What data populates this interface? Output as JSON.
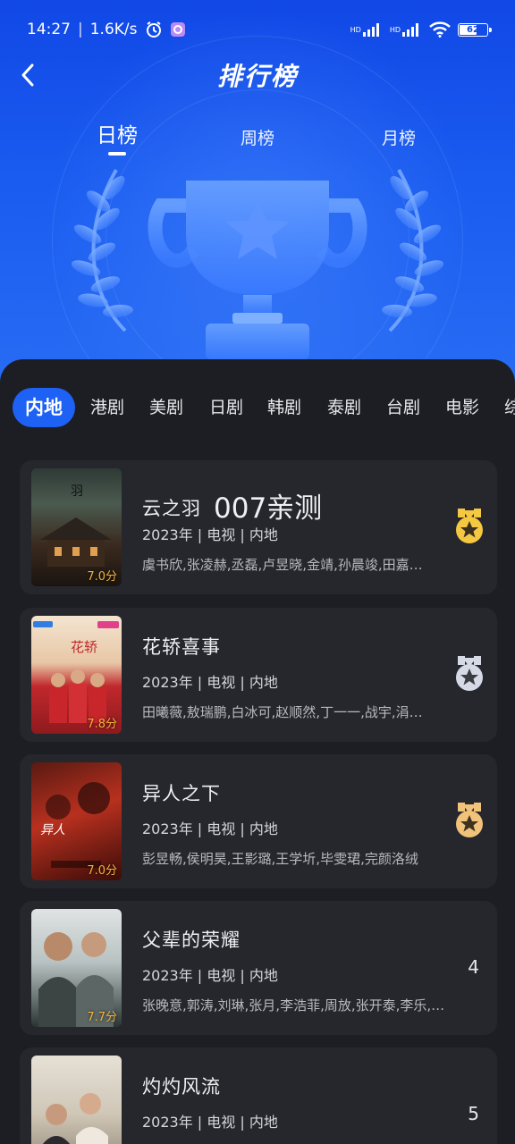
{
  "status_bar": {
    "time": "14:27",
    "speed": "1.6K/s",
    "battery": "62",
    "hd1": "HD",
    "hd2": "HD"
  },
  "header": {
    "title": "排行榜",
    "back_icon": "chevron-left-icon"
  },
  "period_tabs": [
    {
      "label": "日榜",
      "active": true
    },
    {
      "label": "周榜",
      "active": false
    },
    {
      "label": "月榜",
      "active": false
    }
  ],
  "categories": [
    {
      "label": "内地",
      "active": true
    },
    {
      "label": "港剧"
    },
    {
      "label": "美剧"
    },
    {
      "label": "日剧"
    },
    {
      "label": "韩剧"
    },
    {
      "label": "泰剧"
    },
    {
      "label": "台剧"
    },
    {
      "label": "电影"
    },
    {
      "label": "综"
    }
  ],
  "items": [
    {
      "title": "云之羽",
      "extra": "007亲测",
      "meta": "2023年 | 电视 | 内地",
      "cast": "虞书欣,张凌赫,丞磊,卢昱晓,金靖,孙晨竣,田嘉…",
      "score": "7.0分",
      "rank": "1",
      "medal": "gold"
    },
    {
      "title": "花轿喜事",
      "extra": "",
      "meta": "2023年 | 电视 | 内地",
      "cast": "田曦薇,敖瑞鹏,白冰可,赵顺然,丁一一,战宇,涓…",
      "score": "7.8分",
      "rank": "2",
      "medal": "silver"
    },
    {
      "title": "异人之下",
      "extra": "",
      "meta": "2023年 | 电视 | 内地",
      "cast": "彭昱畅,侯明昊,王影璐,王学圻,毕雯珺,完颜洛绒",
      "score": "7.0分",
      "rank": "3",
      "medal": "bronze"
    },
    {
      "title": "父辈的荣耀",
      "extra": "",
      "meta": "2023年 | 电视 | 内地",
      "cast": "张晚意,郭涛,刘琳,张月,李浩菲,周放,张开泰,李乐,…",
      "score": "7.7分",
      "rank": "4",
      "medal": "none"
    },
    {
      "title": "灼灼风流",
      "extra": "",
      "meta": "2023年 | 电视 | 内地",
      "cast": "",
      "score": "",
      "rank": "5",
      "medal": "none"
    }
  ],
  "colors": {
    "accent": "#1e62f5",
    "gold": "#f5c842",
    "silver": "#d5dae6",
    "bronze": "#f1c27a",
    "score": "#f2b33a"
  }
}
